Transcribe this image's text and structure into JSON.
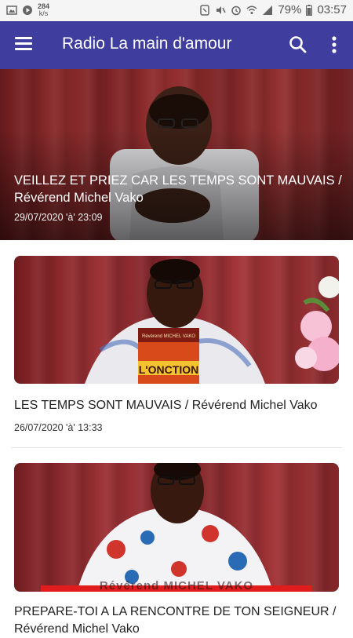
{
  "status_bar": {
    "net_speed_value": "284",
    "net_speed_unit": "k/s",
    "battery": "79%",
    "time": "03:57"
  },
  "app_bar": {
    "title": "Radio La main d'amour",
    "icons": [
      "menu-icon",
      "search-icon",
      "more-vert-icon"
    ]
  },
  "featured": {
    "title": "VEILLEZ ET PRIEZ CAR LES TEMPS SONT MAUVAIS / Révérend Michel Vako",
    "date": "29/07/2020 'à' 23:09"
  },
  "items": [
    {
      "title": "LES TEMPS SONT MAUVAIS / Révérend Michel Vako",
      "date": "26/07/2020 'à' 13:33",
      "book_top_text": "Révérend MICHEL VAKO",
      "book_title": "L'ONCTION"
    },
    {
      "title": "PREPARE-TOI A LA RENCONTRE DE TON SEIGNEUR / Révérend Michel Vako",
      "banner_text": "Révérend MICHEL VAKO"
    }
  ],
  "colors": {
    "app_bar": "#3f3d9d",
    "curtain": "#8c2b2b"
  }
}
